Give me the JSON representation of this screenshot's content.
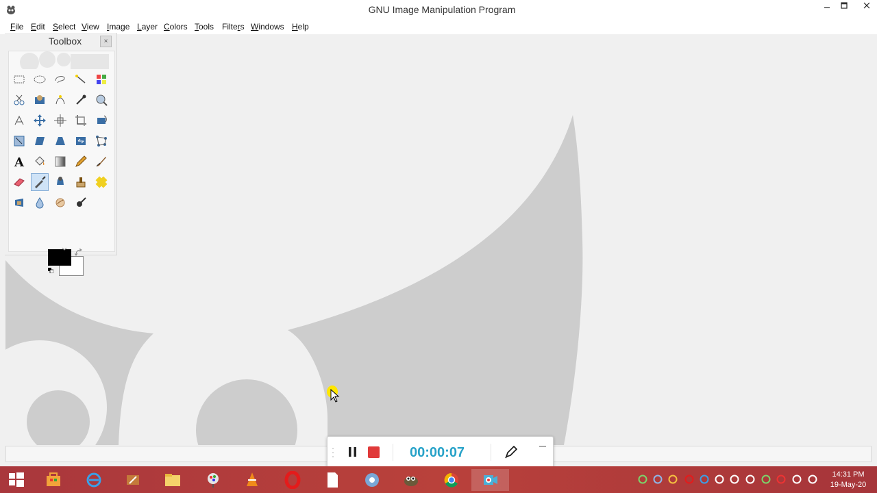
{
  "window": {
    "title": "GNU Image Manipulation Program",
    "controls": [
      "minimize",
      "maximize",
      "close"
    ]
  },
  "menu": [
    {
      "label": "File",
      "mnemonic": "F",
      "rest": "ile"
    },
    {
      "label": "Edit",
      "mnemonic": "E",
      "rest": "dit"
    },
    {
      "label": "Select",
      "mnemonic": "S",
      "rest": "elect"
    },
    {
      "label": "View",
      "mnemonic": "V",
      "rest": "iew"
    },
    {
      "label": "Image",
      "mnemonic": "I",
      "rest": "mage"
    },
    {
      "label": "Layer",
      "mnemonic": "L",
      "rest": "ayer"
    },
    {
      "label": "Colors",
      "mnemonic": "C",
      "rest": "olors"
    },
    {
      "label": "Tools",
      "mnemonic": "T",
      "rest": "ools"
    },
    {
      "label": "Filters",
      "mnemonic": "r",
      "pre": "Filte",
      "rest": "s"
    },
    {
      "label": "Windows",
      "mnemonic": "W",
      "rest": "indows"
    },
    {
      "label": "Help",
      "mnemonic": "H",
      "rest": "elp"
    }
  ],
  "toolbox": {
    "title": "Toolbox",
    "close_glyph": "×",
    "tools": [
      "rect-select",
      "ellipse-select",
      "free-select",
      "fuzzy-select",
      "color-select",
      "scissors",
      "foreground-select",
      "paths",
      "color-picker",
      "zoom",
      "measure",
      "move",
      "align",
      "crop",
      "rotate",
      "scale",
      "shear",
      "perspective",
      "flip",
      "cage-transform",
      "text",
      "bucket-fill",
      "blend",
      "pencil",
      "paintbrush",
      "eraser",
      "airbrush",
      "ink",
      "clone",
      "heal",
      "perspective-clone",
      "blur",
      "smudge",
      "dodge-burn"
    ],
    "selected_tool": "airbrush",
    "foreground_color": "#000000",
    "background_color": "#ffffff"
  },
  "recorder": {
    "time": "00:00:07",
    "pause_color": "#222222",
    "stop_color": "#e03a3a"
  },
  "taskbar": {
    "apps": [
      "start",
      "store",
      "internet-explorer",
      "media-tool",
      "file-explorer",
      "paint-tool",
      "vlc",
      "opera",
      "document",
      "chrome-alt",
      "gimp",
      "chrome",
      "recorder"
    ],
    "active_app": "recorder",
    "clock_time": "14:31 PM",
    "clock_date": "19-May-20"
  },
  "colors": {
    "taskbar": "#b03a3c",
    "wilber_shape": "#cdcdcd",
    "recorder_time": "#27a2c8"
  }
}
